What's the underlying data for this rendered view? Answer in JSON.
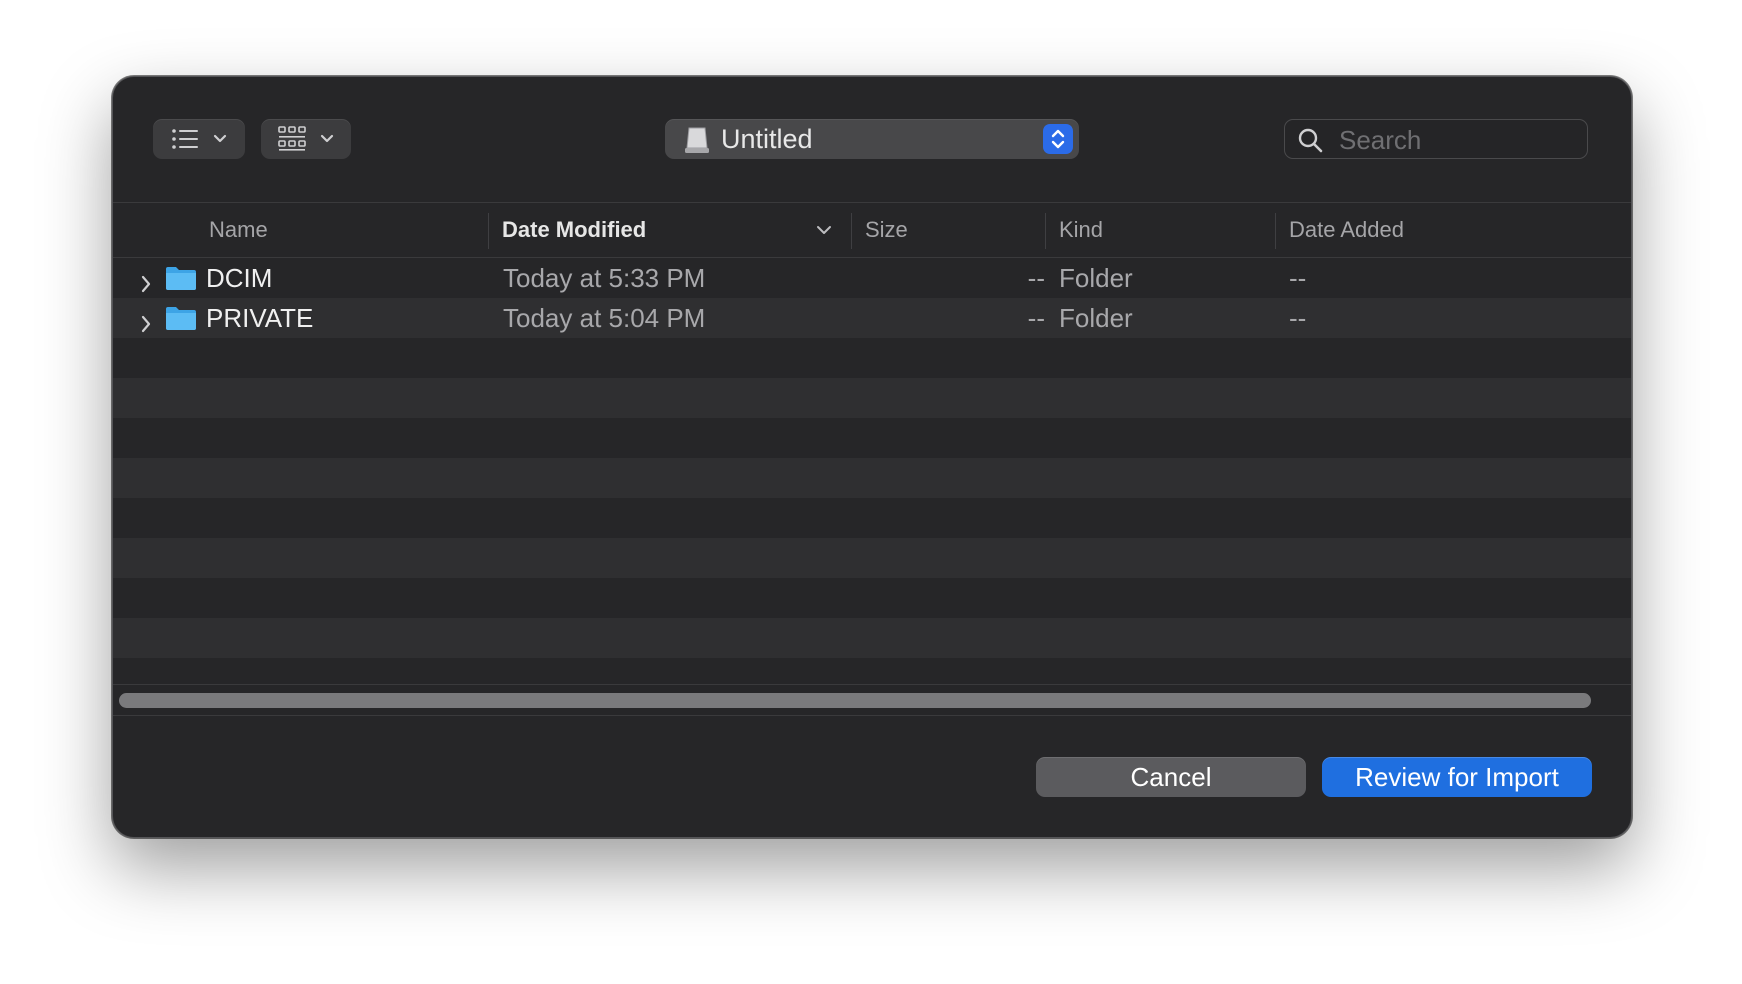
{
  "toolbar": {
    "list_view_icon": "list-icon",
    "grid_view_icon": "grid-icon",
    "location": {
      "label": "Untitled",
      "icon": "drive-icon"
    },
    "search": {
      "placeholder": "Search",
      "value": ""
    }
  },
  "table": {
    "columns": {
      "name": "Name",
      "date_modified": "Date Modified",
      "size": "Size",
      "kind": "Kind",
      "date_added": "Date Added"
    },
    "sorted_by": "Date Modified",
    "rows": [
      {
        "name": "DCIM",
        "date_modified": "Today at 5:33 PM",
        "size": "--",
        "kind": "Folder",
        "date_added": "--"
      },
      {
        "name": "PRIVATE",
        "date_modified": "Today at 5:04 PM",
        "size": "--",
        "kind": "Folder",
        "date_added": "--"
      }
    ]
  },
  "footer": {
    "cancel_label": "Cancel",
    "import_label": "Review for Import"
  },
  "colors": {
    "dialog_bg": "#262628",
    "accent": "#1f6fe0",
    "folder": "#4fb5f2"
  }
}
